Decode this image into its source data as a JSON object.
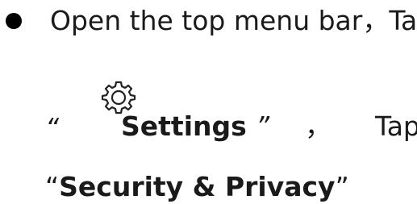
{
  "step": {
    "line1": "Open the top menu bar，Tap",
    "open_quote": "“",
    "settings_label": "Settings",
    "close_quote": "”",
    "comma": "，",
    "tap": "Tap",
    "line3_open_quote": "“",
    "security_label": "Security & Privacy",
    "line3_close_quote": "”"
  },
  "icons": {
    "bullet": "bullet-icon",
    "settings": "gear-icon"
  }
}
